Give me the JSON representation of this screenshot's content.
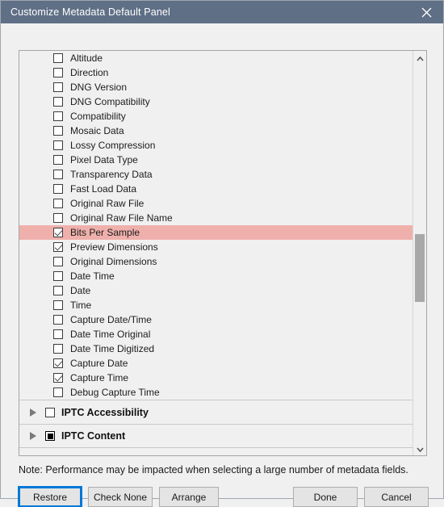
{
  "window": {
    "title": "Customize Metadata Default Panel",
    "close_icon": "close-icon"
  },
  "list": {
    "fields": [
      {
        "label": "Altitude",
        "state": "unchecked",
        "highlighted": false
      },
      {
        "label": "Direction",
        "state": "unchecked",
        "highlighted": false
      },
      {
        "label": "DNG Version",
        "state": "unchecked",
        "highlighted": false
      },
      {
        "label": "DNG Compatibility",
        "state": "unchecked",
        "highlighted": false
      },
      {
        "label": "Compatibility",
        "state": "unchecked",
        "highlighted": false
      },
      {
        "label": "Mosaic Data",
        "state": "unchecked",
        "highlighted": false
      },
      {
        "label": "Lossy Compression",
        "state": "unchecked",
        "highlighted": false
      },
      {
        "label": "Pixel Data Type",
        "state": "unchecked",
        "highlighted": false
      },
      {
        "label": "Transparency Data",
        "state": "unchecked",
        "highlighted": false
      },
      {
        "label": "Fast Load Data",
        "state": "unchecked",
        "highlighted": false
      },
      {
        "label": "Original Raw File",
        "state": "unchecked",
        "highlighted": false
      },
      {
        "label": "Original Raw File Name",
        "state": "unchecked",
        "highlighted": false
      },
      {
        "label": "Bits Per Sample",
        "state": "checked",
        "highlighted": true
      },
      {
        "label": "Preview Dimensions",
        "state": "checked",
        "highlighted": false
      },
      {
        "label": "Original Dimensions",
        "state": "unchecked",
        "highlighted": false
      },
      {
        "label": "Date Time",
        "state": "unchecked",
        "highlighted": false
      },
      {
        "label": "Date",
        "state": "unchecked",
        "highlighted": false
      },
      {
        "label": "Time",
        "state": "unchecked",
        "highlighted": false
      },
      {
        "label": "Capture Date/Time",
        "state": "unchecked",
        "highlighted": false
      },
      {
        "label": "Date Time Original",
        "state": "unchecked",
        "highlighted": false
      },
      {
        "label": "Date Time Digitized",
        "state": "unchecked",
        "highlighted": false
      },
      {
        "label": "Capture Date",
        "state": "checked",
        "highlighted": false
      },
      {
        "label": "Capture Time",
        "state": "checked",
        "highlighted": false
      },
      {
        "label": "Debug Capture Time",
        "state": "unchecked",
        "highlighted": false
      }
    ],
    "groups": [
      {
        "label": "IPTC Accessibility",
        "state": "unchecked",
        "expander": "triangle-right-icon"
      },
      {
        "label": "IPTC Content",
        "state": "indeterminate",
        "expander": "triangle-right-icon"
      }
    ]
  },
  "scrollbar": {
    "up_arrow_icon": "chevron-up-icon",
    "down_arrow_icon": "chevron-down-icon"
  },
  "footer": {
    "note": "Note: Performance may be impacted when selecting a large number of metadata fields.",
    "buttons": {
      "restore": "Restore",
      "check_none": "Check None",
      "arrange": "Arrange",
      "done": "Done",
      "cancel": "Cancel"
    }
  },
  "colors": {
    "titlebar": "#5f6f86",
    "highlight_row": "#efb0ac",
    "focus_ring": "#0078d7",
    "scroll_thumb": "#a8a8a8",
    "dialog_bg": "#f0f0f0"
  }
}
